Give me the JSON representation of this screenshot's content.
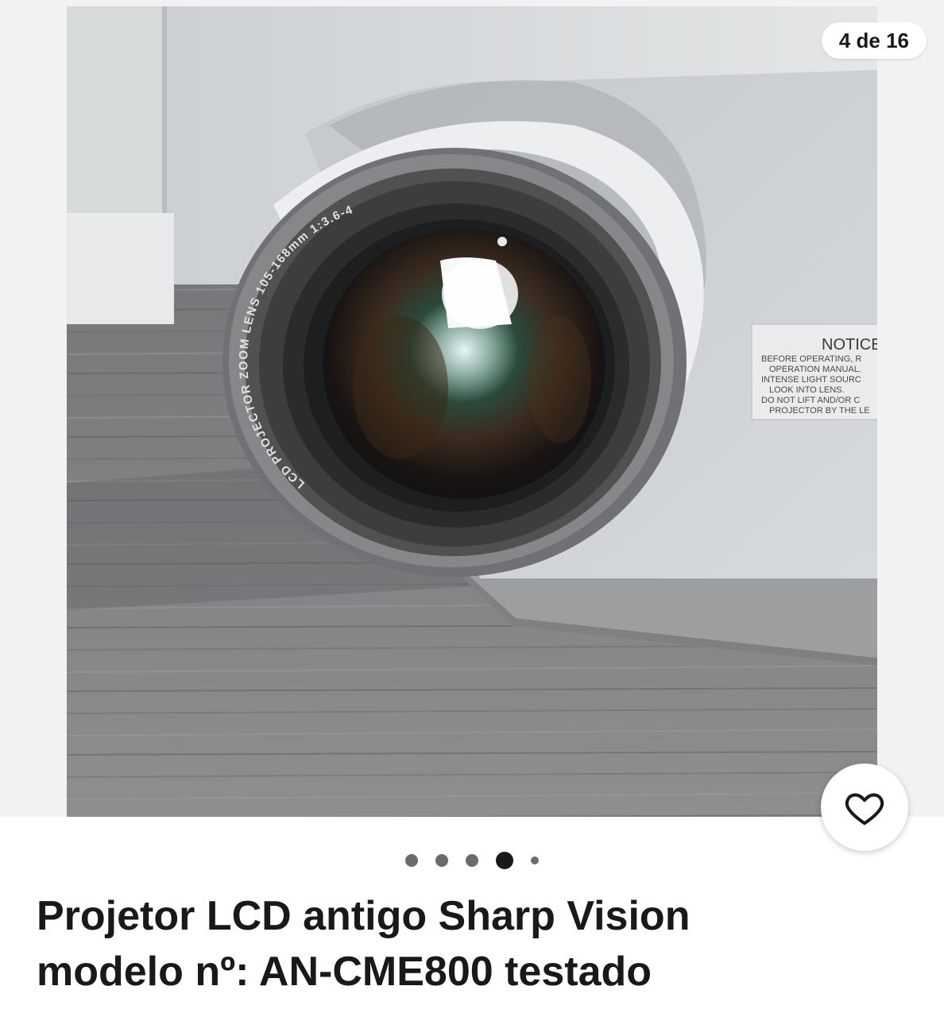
{
  "gallery": {
    "counter": "4 de 16",
    "dots_count": 5,
    "active_dot_index": 3
  },
  "photo": {
    "lens_text": "LCD PROJECTOR ZOOM LENS 105-168mm 1:3.6-4.6",
    "notice_title": "NOTICE",
    "notice_lines": [
      "BEFORE OPERATING, R",
      "OPERATION MANUAL.",
      "INTENSE LIGHT SOURC",
      "LOOK INTO LENS.",
      "DO NOT LIFT AND/OR C",
      "PROJECTOR BY THE LE"
    ]
  },
  "listing": {
    "title_line1": "Projetor LCD antigo Sharp Vision",
    "title_line2": "modelo nº: AN-CME800 testado"
  },
  "colors": {
    "text": "#191919",
    "dot": "#6b6b6b",
    "background": "#ffffff"
  },
  "icons": {
    "favorite": "heart-outline-icon"
  }
}
